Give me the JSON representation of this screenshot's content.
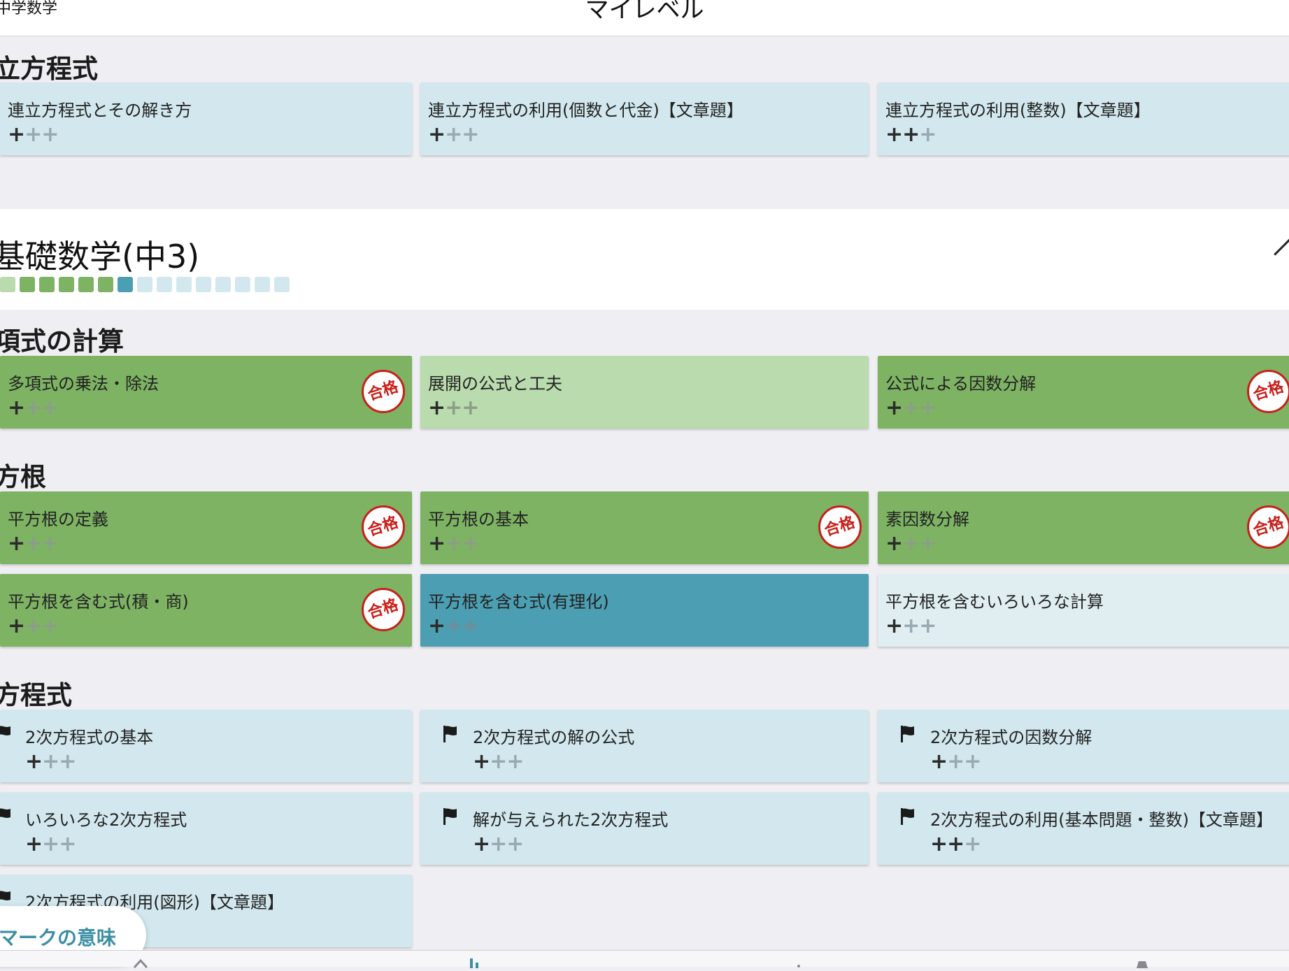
{
  "header": {
    "back_label": "中学数学",
    "title": "マイレベル"
  },
  "section_top": {
    "title": "立方程式",
    "cards": [
      {
        "name": "連立方程式とその解き方",
        "level": 1,
        "style": "blue"
      },
      {
        "name": "連立方程式の利用(個数と代金)【文章題】",
        "level": 1,
        "style": "blue"
      },
      {
        "name": "連立方程式の利用(整数)【文章題】",
        "level": 2,
        "style": "blue"
      }
    ]
  },
  "course": {
    "title": "基礎数学(中3)",
    "progress": [
      "#b9dbad",
      "#7db363",
      "#7db363",
      "#7db363",
      "#7db363",
      "#7db363",
      "#4c9fb3",
      "#d2e8ee",
      "#d2e8ee",
      "#d2e8ee",
      "#d2e8ee",
      "#d2e8ee",
      "#d2e8ee",
      "#d2e8ee",
      "#d2e8ee"
    ]
  },
  "section_poly": {
    "title": "項式の計算",
    "cards": [
      {
        "name": "多項式の乗法・除法",
        "level": 1,
        "style": "green",
        "stamp": "合格"
      },
      {
        "name": "展開の公式と工夫",
        "level": 1,
        "style": "lightgreen"
      },
      {
        "name": "公式による因数分解",
        "level": 1,
        "style": "green",
        "stamp": "合格"
      }
    ]
  },
  "section_root": {
    "title": "方根",
    "cards": [
      {
        "name": "平方根の定義",
        "level": 1,
        "style": "green",
        "stamp": "合格"
      },
      {
        "name": "平方根の基本",
        "level": 1,
        "style": "green",
        "stamp": "合格"
      },
      {
        "name": "素因数分解",
        "level": 1,
        "style": "green",
        "stamp": "合格"
      },
      {
        "name": "平方根を含む式(積・商)",
        "level": 1,
        "style": "green",
        "stamp": "合格"
      },
      {
        "name": "平方根を含む式(有理化)",
        "level": 1,
        "style": "teal"
      },
      {
        "name": "平方根を含むいろいろな計算",
        "level": 1,
        "style": "white"
      }
    ]
  },
  "section_quad": {
    "title": "方程式",
    "cards": [
      {
        "name": "2次方程式の基本",
        "level": 1,
        "style": "blue"
      },
      {
        "name": "2次方程式の解の公式",
        "level": 1,
        "style": "blue"
      },
      {
        "name": "2次方程式の因数分解",
        "level": 1,
        "style": "blue"
      },
      {
        "name": "いろいろな2次方程式",
        "level": 1,
        "style": "blue"
      },
      {
        "name": "解が与えられた2次方程式",
        "level": 1,
        "style": "blue"
      },
      {
        "name": "2次方程式の利用(基本問題・整数)【文章題】",
        "level": 2,
        "style": "blue"
      },
      {
        "name": "2次方程式の利用(図形)【文章題】",
        "level": 1,
        "style": "blue"
      }
    ]
  },
  "plus_symbol": "+",
  "legend_button": "マークの意味",
  "icons": {
    "flag": "flag-icon",
    "stamp": "pass-stamp-icon",
    "collapse": "chevron-up-icon"
  }
}
